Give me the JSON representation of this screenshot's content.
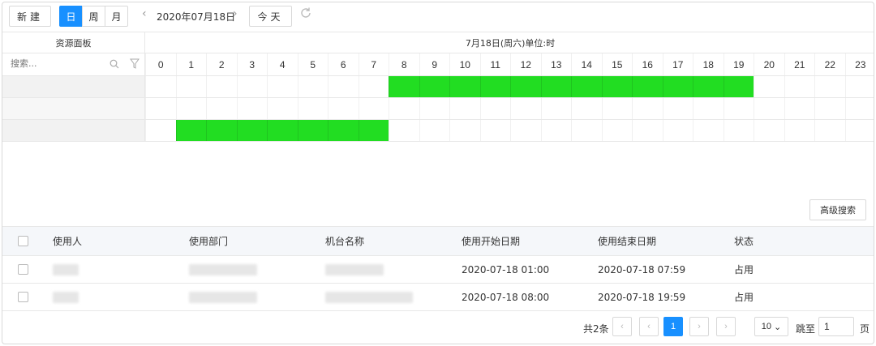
{
  "toolbar": {
    "new_label": "新建",
    "views": [
      {
        "label": "日",
        "active": true
      },
      {
        "label": "周",
        "active": false
      },
      {
        "label": "月",
        "active": false
      }
    ],
    "prev_icon": "chevron-left-icon",
    "next_icon": "chevron-right-icon",
    "current_date": "2020年07月18日",
    "today_label": "今天",
    "refresh_icon": "refresh-icon"
  },
  "scheduler": {
    "resource_panel_title": "资源面板",
    "day_title": "7月18日(周六)单位:时",
    "search_placeholder": "搜索...",
    "hours": [
      "0",
      "1",
      "2",
      "3",
      "4",
      "5",
      "6",
      "7",
      "8",
      "9",
      "10",
      "11",
      "12",
      "13",
      "14",
      "15",
      "16",
      "17",
      "18",
      "19",
      "20",
      "21",
      "22",
      "23"
    ],
    "busy_color": "#22dd22",
    "rows": [
      {
        "busy_from": 8,
        "busy_to": 20
      },
      {
        "busy_from": null,
        "busy_to": null
      },
      {
        "busy_from": 1,
        "busy_to": 8
      }
    ]
  },
  "advanced_search_label": "高级搜索",
  "table": {
    "columns": [
      "使用人",
      "使用部门",
      "机台名称",
      "使用开始日期",
      "使用结束日期",
      "状态"
    ],
    "rows": [
      {
        "start": "2020-07-18 01:00",
        "end": "2020-07-18 07:59",
        "status": "占用"
      },
      {
        "start": "2020-07-18 08:00",
        "end": "2020-07-18 19:59",
        "status": "占用"
      }
    ]
  },
  "pagination": {
    "total": "共2条",
    "current_page": "1",
    "page_size": "10",
    "jump_label": "跳至",
    "jump_value": "1",
    "page_unit": "页"
  },
  "colors": {
    "primary": "#1890ff",
    "busy": "#22dd22"
  }
}
